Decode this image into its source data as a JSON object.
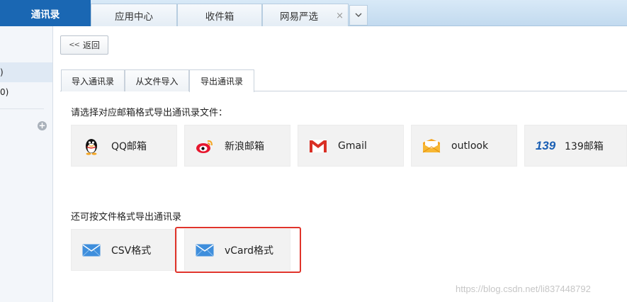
{
  "top_tabs": [
    {
      "label": "通讯录",
      "active": true
    },
    {
      "label": "应用中心",
      "active": false
    },
    {
      "label": "收件箱",
      "active": false
    },
    {
      "label": "网易严选",
      "active": false,
      "closable": true
    }
  ],
  "top_close_glyph": "×",
  "top_more_glyph": "⌄",
  "sidebar": {
    "items": [
      {
        "label": ")",
        "selected": true
      },
      {
        "label": "0)",
        "selected": false
      }
    ],
    "add_glyph": "+"
  },
  "back_button": {
    "icon": "double-chevron-left-icon",
    "glyph": "<<",
    "label": "返回"
  },
  "sub_tabs": [
    {
      "label": "导入通讯录",
      "active": false
    },
    {
      "label": "从文件导入",
      "active": false
    },
    {
      "label": "导出通讯录",
      "active": true
    }
  ],
  "export_by_mailbox": {
    "prompt": "请选择对应邮箱格式导出通讯录文件：",
    "options": [
      {
        "label": "QQ邮箱",
        "icon": "qq-penguin-icon"
      },
      {
        "label": "新浪邮箱",
        "icon": "sina-weibo-icon"
      },
      {
        "label": "Gmail",
        "icon": "gmail-icon"
      },
      {
        "label": "outlook",
        "icon": "outlook-envelope-icon"
      },
      {
        "label": "139邮箱",
        "icon": "139-logo-icon",
        "logo_text": "139"
      }
    ]
  },
  "export_by_file": {
    "prompt": "还可按文件格式导出通讯录",
    "options": [
      {
        "label": "CSV格式",
        "icon": "envelope-icon"
      },
      {
        "label": "vCard格式",
        "icon": "envelope-icon",
        "highlighted": true
      }
    ]
  },
  "watermark": "https://blog.csdn.net/li837448792",
  "colors": {
    "active_tab": "#1a67b3",
    "highlight": "#e0342b",
    "tile_bg": "#f2f2f2"
  }
}
